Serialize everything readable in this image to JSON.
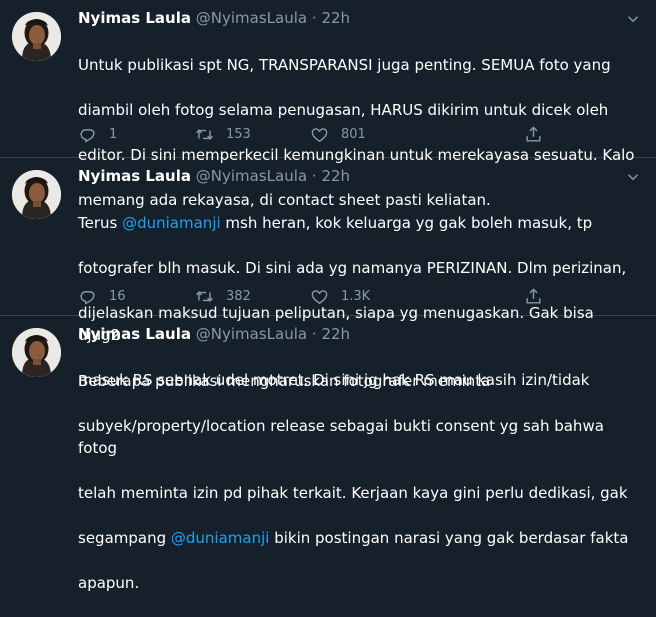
{
  "tweets": [
    {
      "name": "Nyimas Laula",
      "handle": "@NyimasLaula",
      "separator": "·",
      "time": "22h",
      "text_lines": [
        "Untuk publikasi spt NG, TRANSPARANSI juga penting. SEMUA foto yang",
        "diambil oleh fotog selama penugasan, HARUS dikirim untuk dicek oleh",
        "editor. Di sini memperkecil kemungkinan untuk merekayasa sesuatu. Kalo",
        "memang ada rekayasa, di contact sheet pasti keliatan."
      ],
      "replies": "1",
      "retweets": "153",
      "likes": "801"
    },
    {
      "name": "Nyimas Laula",
      "handle": "@NyimasLaula",
      "separator": "·",
      "time": "22h",
      "text_pre": "Terus ",
      "mention": "@duniamanji",
      "text_line1_post": " msh heran, kok keluarga yg gak boleh masuk, tp",
      "text_lines": [
        "fotografer blh masuk. Di sini ada yg namanya PERIZINAN. Dlm perizinan,",
        "dijelaskan maksud tujuan peliputan, siapa yg menugaskan. Gak bisa ujug2",
        "masuk RS seenak udel motret. Di sini jg hak RS mau kasih izin/tidak"
      ],
      "replies": "16",
      "retweets": "382",
      "likes": "1.3K"
    },
    {
      "name": "Nyimas Laula",
      "handle": "@NyimasLaula",
      "separator": "·",
      "time": "22h",
      "text_lines": [
        "Beberapa publikasi mengharuskan fotografer meminta",
        "subyek/property/location release sebagai bukti consent yg sah bahwa fotog",
        "telah meminta izin pd pihak terkait. Kerjaan kaya gini perlu dedikasi, gak"
      ],
      "line4_pre": "segampang ",
      "mention": "@duniamanji",
      "line4_post": " bikin postingan narasi yang gak berdasar fakta",
      "line5": "apapun."
    }
  ],
  "colors": {
    "background": "#15202b",
    "text": "#ffffff",
    "muted": "#8899a6",
    "link": "#1da1f2",
    "divider": "#38444d"
  },
  "icons": [
    "avatar",
    "chevron-down-icon",
    "reply-icon",
    "retweet-icon",
    "like-icon",
    "share-icon"
  ]
}
